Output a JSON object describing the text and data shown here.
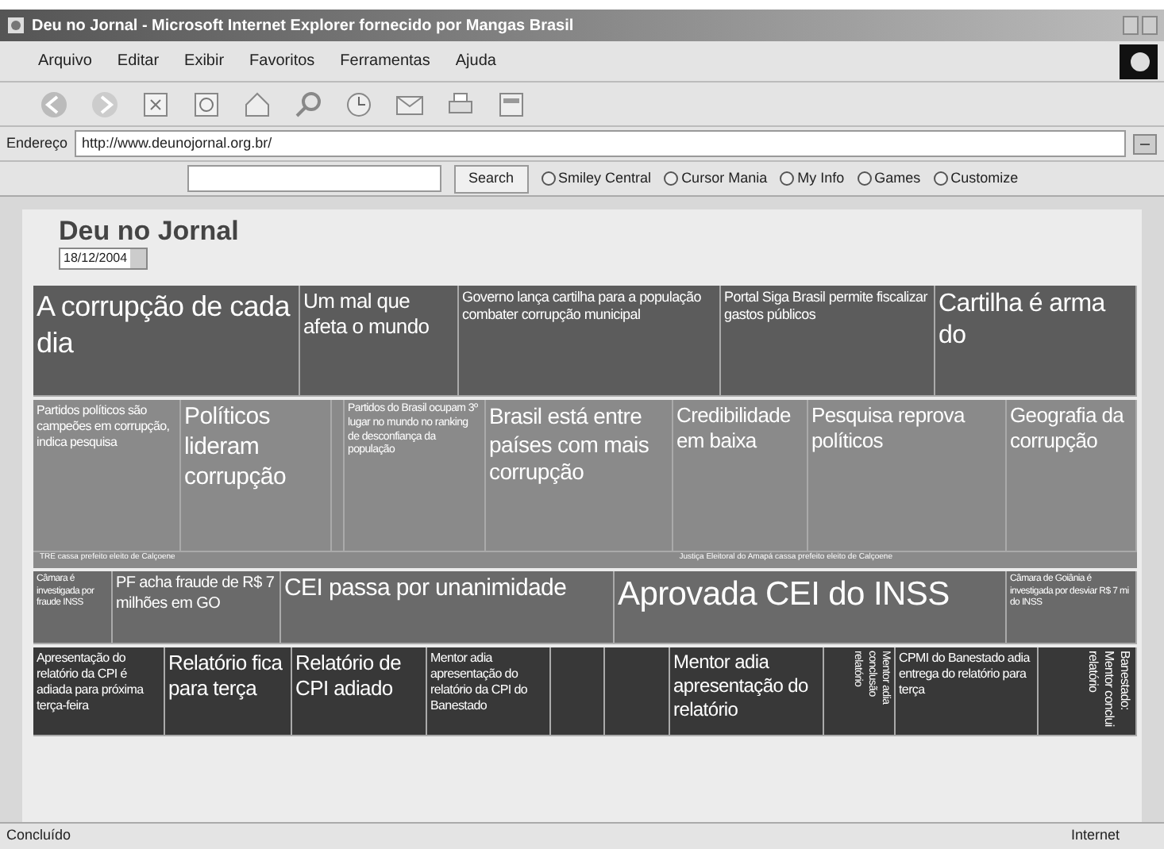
{
  "window": {
    "title": "Deu no Jornal - Microsoft Internet Explorer fornecido por Mangas Brasil"
  },
  "menu": [
    "Arquivo",
    "Editar",
    "Exibir",
    "Favoritos",
    "Ferramentas",
    "Ajuda"
  ],
  "address": {
    "label": "Endereço",
    "url": "http://www.deunojornal.org.br/"
  },
  "links_bar": {
    "search_button": "Search",
    "links": [
      "Smiley Central",
      "Cursor Mania",
      "My Info",
      "Games",
      "Customize"
    ]
  },
  "page": {
    "title": "Deu no Jornal",
    "date": "18/12/2004"
  },
  "treemap": [
    {
      "cells": [
        {
          "text": "A corrupção de cada dia"
        },
        {
          "text": "Um mal que afeta o mundo"
        },
        {
          "text": "Governo lança cartilha para a população combater corrupção municipal"
        },
        {
          "text": "Portal Siga Brasil permite fiscalizar gastos públicos"
        },
        {
          "text": "Cartilha é arma do"
        }
      ]
    },
    {
      "cells": [
        {
          "text": "Partidos políticos são campeões em corrupção, indica pesquisa"
        },
        {
          "text": "Políticos lideram corrupção"
        },
        {
          "text": ""
        },
        {
          "text": "Partidos do Brasil ocupam 3º lugar no mundo no ranking de desconfiança da população"
        },
        {
          "text": "Brasil está entre países com mais corrupção"
        },
        {
          "text": "Credibilidade em baixa"
        },
        {
          "text": "Pesquisa reprova políticos"
        },
        {
          "text": "Geografia da corrupção"
        }
      ],
      "captions": [
        "TRE cassa prefeito eleito de Calçoene",
        "Justiça Eleitoral do Amapá cassa prefeito eleito de Calçoene"
      ]
    },
    {
      "cells": [
        {
          "text": "Câmara é investigada por fraude INSS"
        },
        {
          "text": "PF acha fraude de R$ 7 milhões em GO"
        },
        {
          "text": "CEI passa por unanimidade"
        },
        {
          "text": "Aprovada CEI do INSS"
        },
        {
          "text": "Câmara de Goiânia é investigada por desviar R$ 7 mi do INSS"
        }
      ]
    },
    {
      "cells": [
        {
          "text": "Apresentação do relatório da CPI é adiada para próxima terça-feira"
        },
        {
          "text": "Relatório fica para terça"
        },
        {
          "text": "Relatório de CPI adiado"
        },
        {
          "text": "Mentor adia apresentação do relatório da CPI do Banestado"
        },
        {
          "text": "",
          "kind": "vertical"
        },
        {
          "text": "",
          "kind": "vertical"
        },
        {
          "text": "Mentor adia apresentação do relatório"
        },
        {
          "text": "Mentor adia conclusão relatório",
          "kind": "vertical"
        },
        {
          "text": "CPMI do Banestado adia entrega do relatório para terça"
        },
        {
          "text": "Banestado: Mentor conclui relatório",
          "kind": "vertical"
        }
      ]
    }
  ],
  "status_bar": {
    "text": "Concluído",
    "zone": "Internet"
  }
}
